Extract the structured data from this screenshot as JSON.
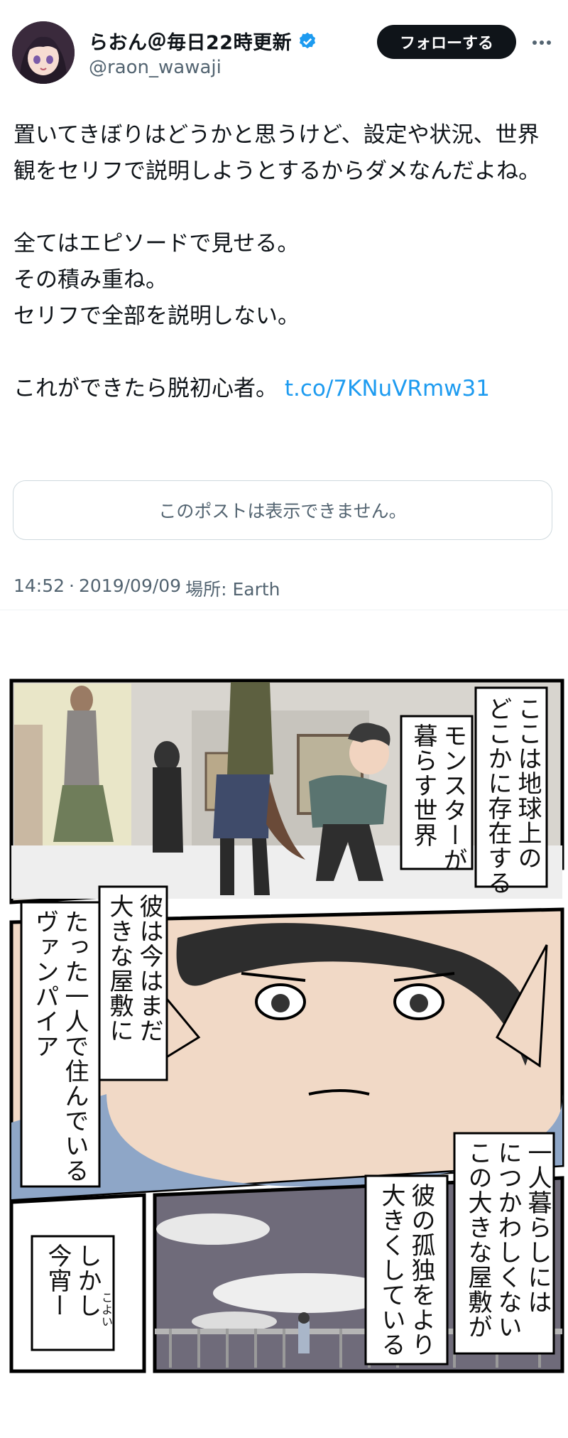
{
  "user": {
    "display_name": "らおん＠毎日22時更新",
    "handle": "@raon_wawaji",
    "follow_label": "フォローする"
  },
  "tweet": {
    "text": "置いてきぼりはどうかと思うけど、設定や状況、世界観をセリフで説明しようとするからダメなんだよね。\n\n全てはエピソードで見せる。\nその積み重ね。\nセリフで全部を説明しない。\n\nこれができたら脱初心者。 ",
    "link": "t.co/7KNuVRmw31",
    "quote_unavailable": "このポストは表示できません。",
    "time": "14:52",
    "separator": "·",
    "date": "2019/09/09",
    "location": "場所: Earth"
  },
  "manga": {
    "panel1_caption": "ここは地球上の\nどこかに存在する",
    "panel1_caption2": "モンスターが\n暮らす世界",
    "panel2_caption": "彼は今はまだ\n大きな屋敷に",
    "panel2_caption2": "たった一人で住んでいる\nヴァンパイア",
    "panel3_caption": "一人暮らしには\nにつかわしくない\nこの大きな屋敷が",
    "panel3_caption2": "彼の孤独をより\n大きくしている",
    "panel4_caption": "しかし\n今宵ー",
    "panel4_ruby": "こよい"
  },
  "colors": {
    "accent": "#1d9bf0",
    "verified": "#1d9bf0",
    "follow_bg": "#0f1419",
    "secondary_text": "#536471"
  },
  "icons": [
    "verified-badge-icon",
    "more-options-icon"
  ]
}
